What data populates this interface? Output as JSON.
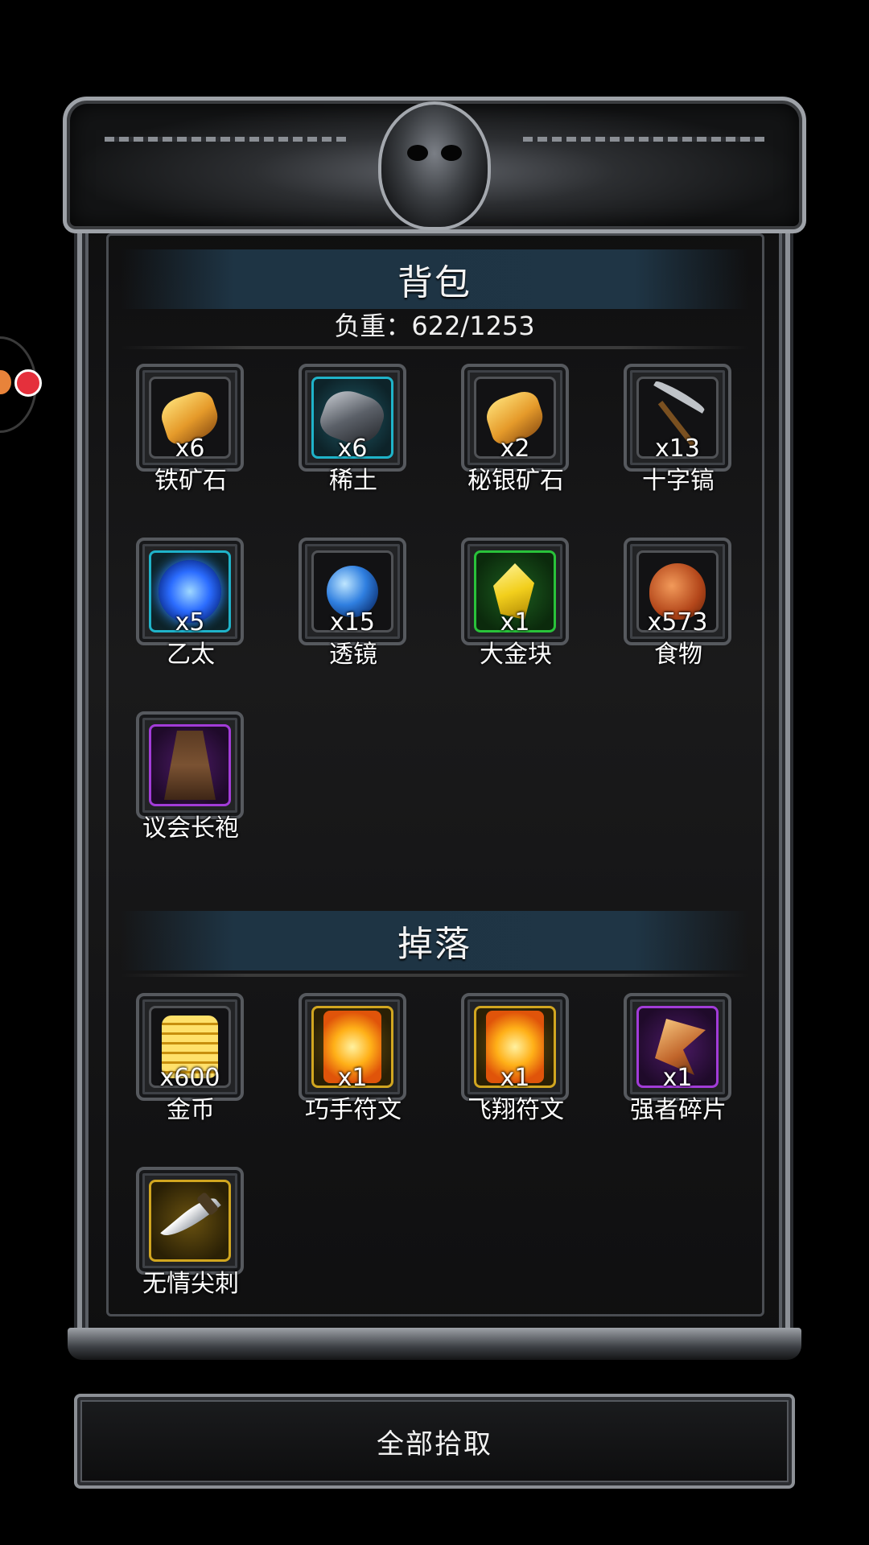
{
  "backpack": {
    "title": "背包",
    "capacity": "负重：622/1253",
    "items": [
      {
        "name": "铁矿石",
        "qty": "x6",
        "icon": "iron-ore-icon",
        "rarity": "gray"
      },
      {
        "name": "稀土",
        "qty": "x6",
        "icon": "rare-earth-icon",
        "rarity": "cyan"
      },
      {
        "name": "秘银矿石",
        "qty": "x2",
        "icon": "mithril-ore-icon",
        "rarity": "gray"
      },
      {
        "name": "十字镐",
        "qty": "x13",
        "icon": "pickaxe-icon",
        "rarity": "gray"
      },
      {
        "name": "乙太",
        "qty": "x5",
        "icon": "ether-orb-icon",
        "rarity": "cyan"
      },
      {
        "name": "透镜",
        "qty": "x15",
        "icon": "lens-icon",
        "rarity": "gray"
      },
      {
        "name": "大金块",
        "qty": "x1",
        "icon": "gold-nugget-icon",
        "rarity": "green"
      },
      {
        "name": "食物",
        "qty": "x573",
        "icon": "meat-icon",
        "rarity": "gray"
      },
      {
        "name": "议会长袍",
        "qty": "",
        "icon": "robe-icon",
        "rarity": "purple"
      }
    ]
  },
  "drops": {
    "title": "掉落",
    "items": [
      {
        "name": "金币",
        "qty": "x600",
        "icon": "gold-coin-icon",
        "rarity": "gray"
      },
      {
        "name": "巧手符文",
        "qty": "x1",
        "icon": "rune-icon",
        "rarity": "gold"
      },
      {
        "name": "飞翔符文",
        "qty": "x1",
        "icon": "rune-icon",
        "rarity": "gold"
      },
      {
        "name": "强者碎片",
        "qty": "x1",
        "icon": "shard-icon",
        "rarity": "purple"
      },
      {
        "name": "无情尖刺",
        "qty": "",
        "icon": "curved-blade-icon",
        "rarity": "gold"
      }
    ]
  },
  "actions": {
    "pick_all": "全部拾取"
  },
  "colors": {
    "frame": "#8c9096",
    "section_bar": "#1f3545",
    "rarity_cyan": "#1fb3c9",
    "rarity_green": "#29c23a",
    "rarity_purple": "#a23cd8",
    "rarity_gold": "#d1a620",
    "notification_dot": "#e5303c"
  }
}
